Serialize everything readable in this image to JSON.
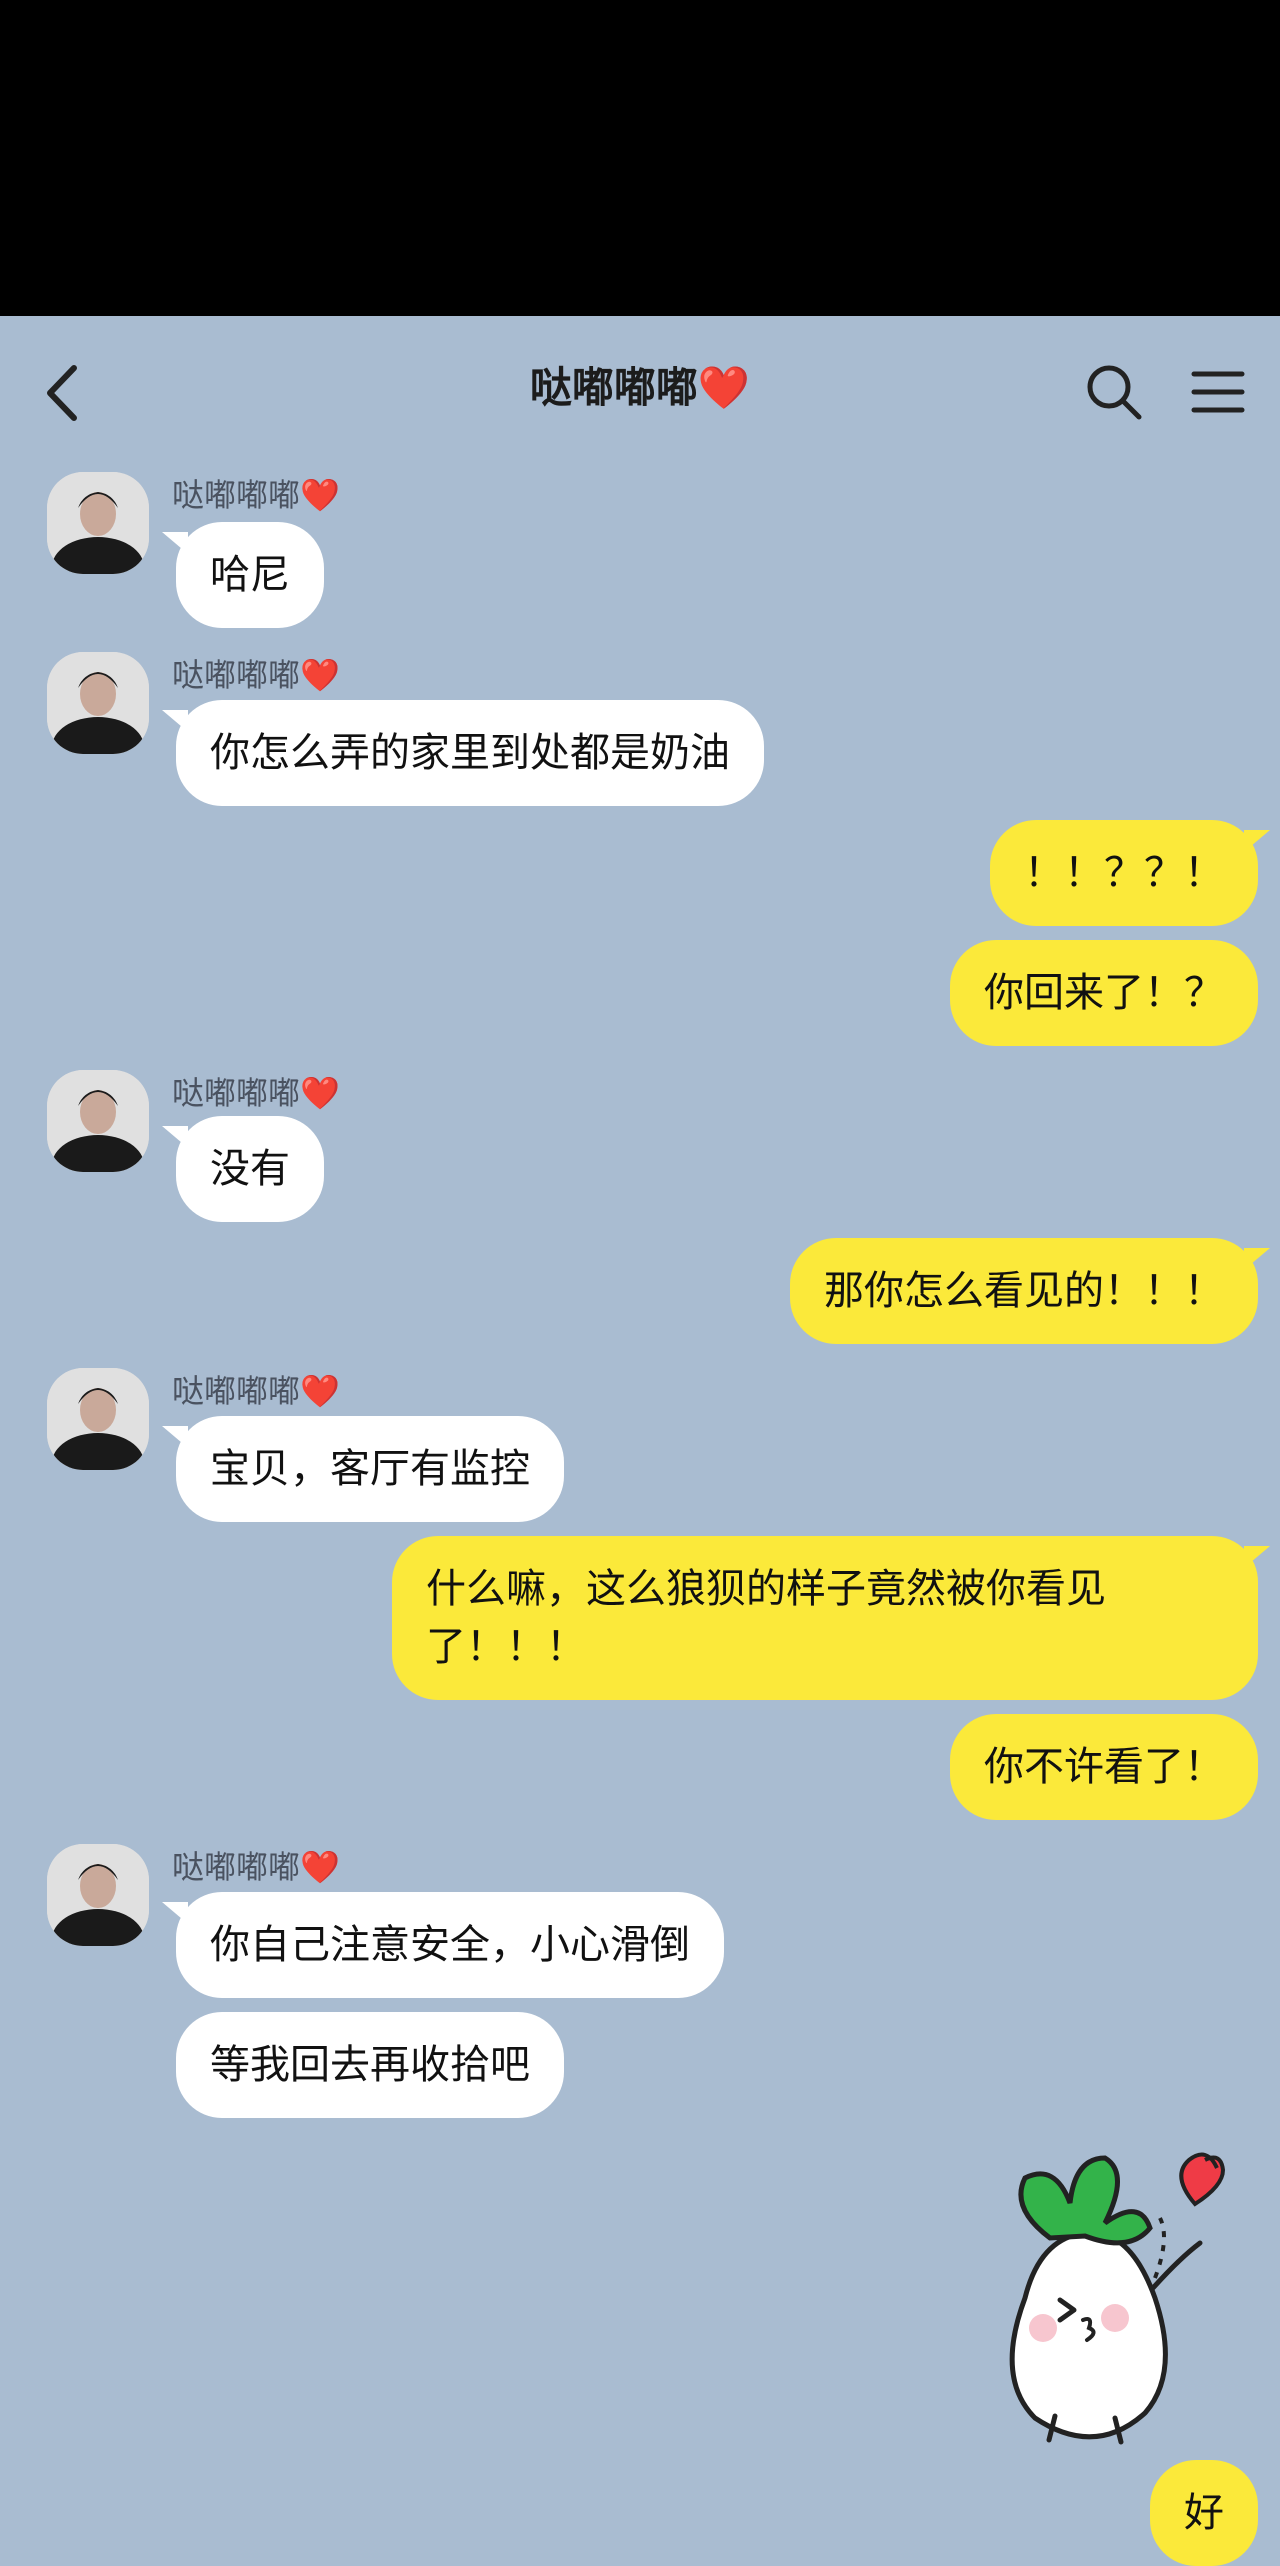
{
  "header": {
    "title": "哒嘟嘟嘟",
    "title_emoji": "❤️",
    "icons": [
      "back-arrow-icon",
      "search-icon",
      "menu-icon"
    ]
  },
  "messages": [
    {
      "side": "in",
      "sender": "哒嘟嘟嘟",
      "text": "哈尼"
    },
    {
      "side": "in",
      "sender": "哒嘟嘟嘟",
      "text": "你怎么弄的家里到处都是奶油"
    },
    {
      "side": "out",
      "text": "！！？？！"
    },
    {
      "side": "out",
      "text": "你回来了！？"
    },
    {
      "side": "in",
      "sender": "哒嘟嘟嘟",
      "text": "没有"
    },
    {
      "side": "out",
      "text": "那你怎么看见的！！！"
    },
    {
      "side": "in",
      "sender": "哒嘟嘟嘟",
      "text": "宝贝，客厅有监控"
    },
    {
      "side": "out",
      "text": "什么嘛，这么狼狈的样子竟然被你看见了！！！"
    },
    {
      "side": "out",
      "text": "你不许看了！"
    },
    {
      "side": "in",
      "sender": "哒嘟嘟嘟",
      "text": "你自己注意安全，小心滑倒"
    },
    {
      "side": "in",
      "text": "等我回去再收拾吧"
    },
    {
      "side": "out",
      "sticker": "radish-kiss-sticker"
    },
    {
      "side": "out",
      "text": "好"
    }
  ],
  "colors": {
    "background": "#a9bcd1",
    "incoming": "#ffffff",
    "outgoing": "#fbe93a",
    "status_bar": "#000000"
  }
}
